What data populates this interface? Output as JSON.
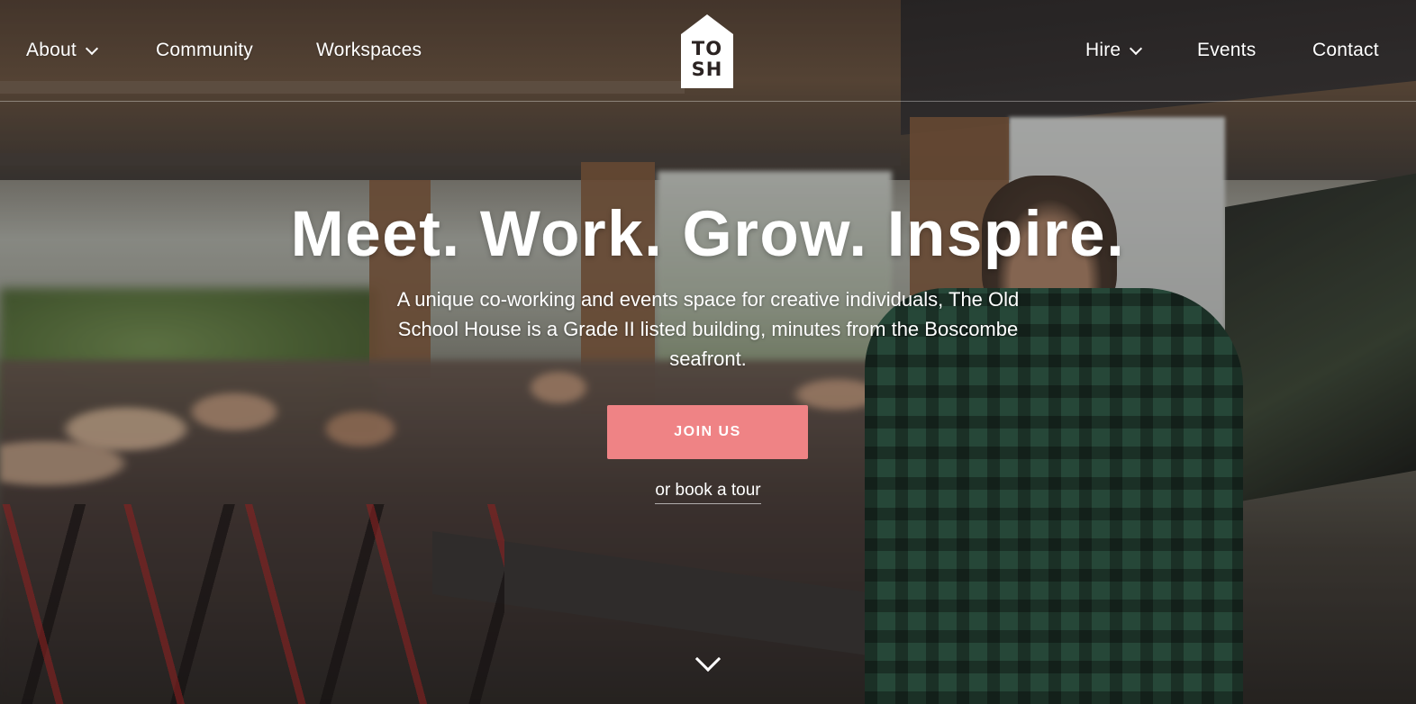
{
  "nav": {
    "left": [
      {
        "label": "About",
        "has_dropdown": true
      },
      {
        "label": "Community",
        "has_dropdown": false
      },
      {
        "label": "Workspaces",
        "has_dropdown": false
      }
    ],
    "right": [
      {
        "label": "Hire",
        "has_dropdown": true
      },
      {
        "label": "Events",
        "has_dropdown": false
      },
      {
        "label": "Contact",
        "has_dropdown": false
      }
    ]
  },
  "logo": {
    "line1": "TO",
    "line2": "SH",
    "icon": "house-logo-icon"
  },
  "hero": {
    "headline": "Meet. Work. Grow. Inspire.",
    "subtext": "A unique co-working and events space for creative individuals, The Old School House is a Grade II listed building, minutes from the Boscombe seafront.",
    "cta_label": "JOIN US",
    "secondary_link": "or book a tour",
    "scroll_icon": "chevron-down-icon"
  },
  "colors": {
    "cta_background": "#ef8385",
    "text": "#ffffff",
    "logo_ink": "#2b2322"
  }
}
